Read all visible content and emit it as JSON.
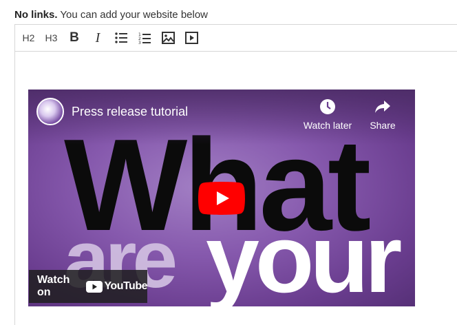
{
  "hint": {
    "strong": "No links.",
    "rest": " You can add your website below"
  },
  "toolbar": {
    "h2": "H2",
    "h3": "H3",
    "bold": "B",
    "italic": "I"
  },
  "video": {
    "title": "Press release tutorial",
    "watch_later": "Watch later",
    "share": "Share",
    "watch_on": "Watch on",
    "youtube": "YouTube",
    "thumb_line1": "What",
    "thumb_line2a": "are",
    "thumb_line2b": "your"
  },
  "icons": {
    "bullet_list": "bullet-list-icon",
    "numbered_list": "numbered-list-icon",
    "image": "image-icon",
    "video": "video-icon",
    "clock": "clock-icon",
    "share": "share-icon",
    "play": "play-icon",
    "youtube": "youtube-logo-icon"
  },
  "colors": {
    "youtube_red": "#ff0000",
    "video_purple": "#8659ad"
  }
}
